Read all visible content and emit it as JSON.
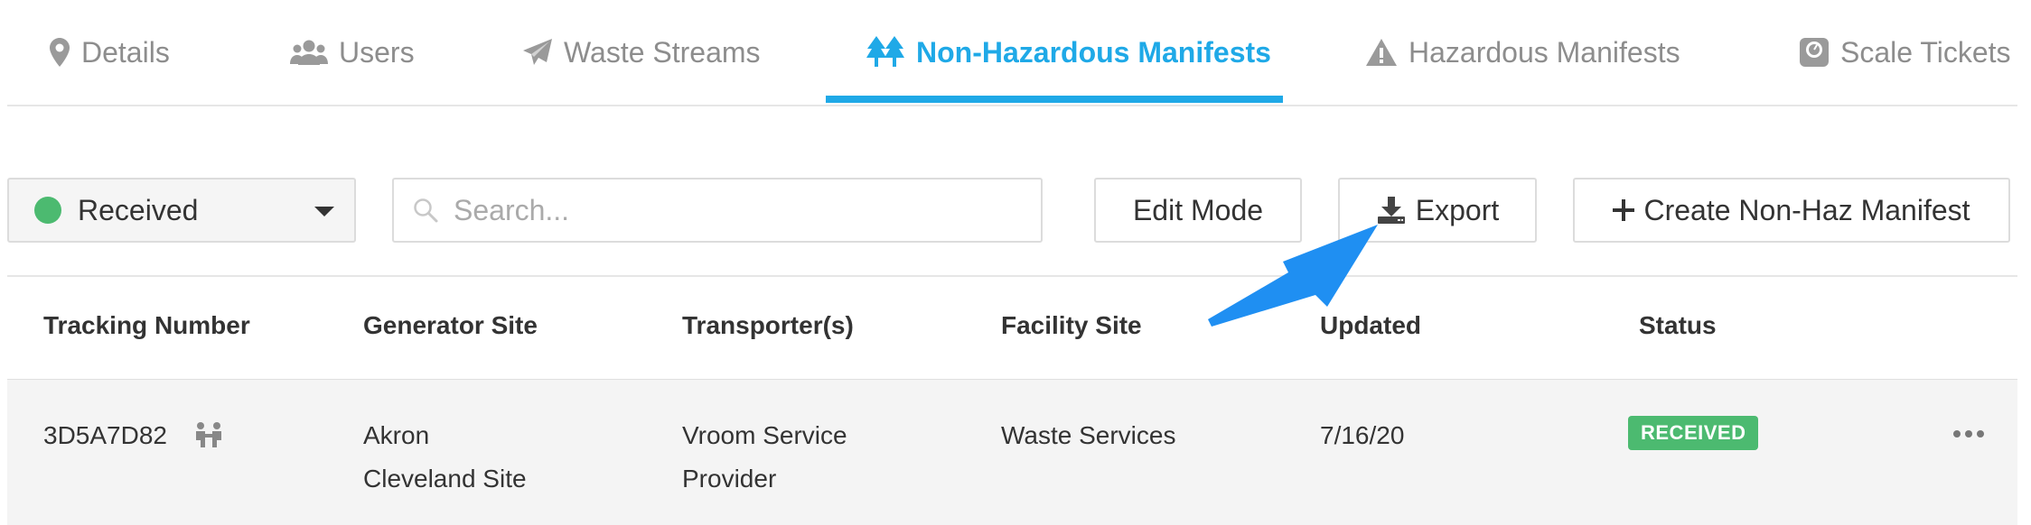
{
  "tabs": [
    {
      "label": "Details",
      "icon": "map-pin-icon"
    },
    {
      "label": "Users",
      "icon": "users-icon"
    },
    {
      "label": "Waste Streams",
      "icon": "paper-plane-icon"
    },
    {
      "label": "Non-Hazardous Manifests",
      "icon": "trees-icon",
      "active": true
    },
    {
      "label": "Hazardous Manifests",
      "icon": "warning-icon"
    },
    {
      "label": "Scale Tickets",
      "icon": "scale-icon"
    }
  ],
  "toolbar": {
    "status_filter": "Received",
    "status_color": "#4cba70",
    "search_placeholder": "Search...",
    "search_value": "",
    "edit_mode": "Edit Mode",
    "export": "Export",
    "create": "Create Non-Haz Manifest"
  },
  "table": {
    "headers": [
      "Tracking Number",
      "Generator Site",
      "Transporter(s)",
      "Facility Site",
      "Updated",
      "Status"
    ],
    "rows": [
      {
        "tracking": "3D5A7D82",
        "generator_line1": "Akron",
        "generator_line2": "Cleveland Site",
        "transporter_line1": "Vroom Service",
        "transporter_line2": "Provider",
        "facility": "Waste Services",
        "updated": "7/16/20",
        "status": "RECEIVED"
      }
    ]
  },
  "colors": {
    "accent": "#1fa9e7",
    "success": "#4cba70",
    "callout_arrow": "#1f8ff2"
  }
}
